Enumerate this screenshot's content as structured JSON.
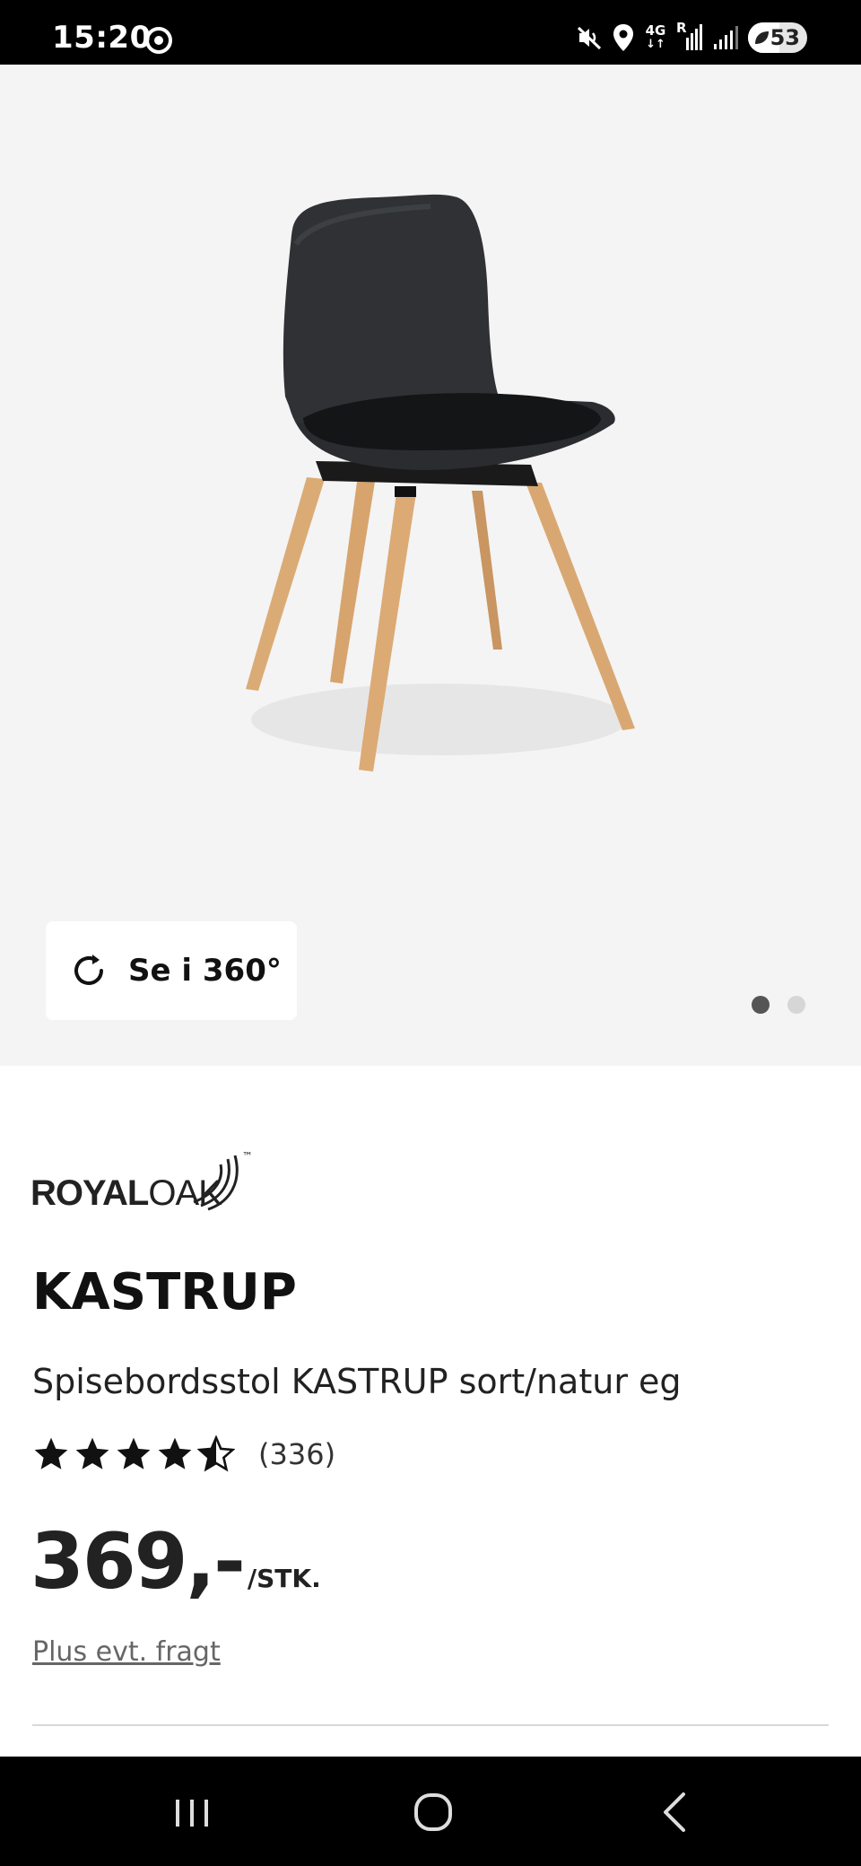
{
  "status_bar": {
    "time": "15:20",
    "network_label_top": "4G",
    "roaming_label": "R",
    "battery_level": "53",
    "battery_fraction": 0.53,
    "icons": [
      "circle-target-icon",
      "mute-vibrate-icon",
      "location-icon",
      "data-arrows-icon",
      "signal-icon",
      "signal-icon-2",
      "battery-icon"
    ]
  },
  "gallery": {
    "view360_label": "Se i 360°",
    "view360_icon": "rotate-icon",
    "page_count": 2,
    "active_page": 1,
    "colors": {
      "background": "#f4f4f4",
      "dot_active": "#555555",
      "dot_inactive": "#d6d6d6"
    }
  },
  "product": {
    "brand": {
      "part1": "ROYAL",
      "part2": "OAK",
      "trademark": "™"
    },
    "name": "KASTRUP",
    "description": "Spisebordsstol KASTRUP sort/natur eg",
    "rating": 4.5,
    "review_count": "(336)",
    "price": "369,-",
    "price_unit": "/STK.",
    "shipping_text": "Plus evt. fragt"
  },
  "nav_bar": {
    "icons": [
      "recent-apps-icon",
      "home-icon",
      "back-icon"
    ]
  }
}
